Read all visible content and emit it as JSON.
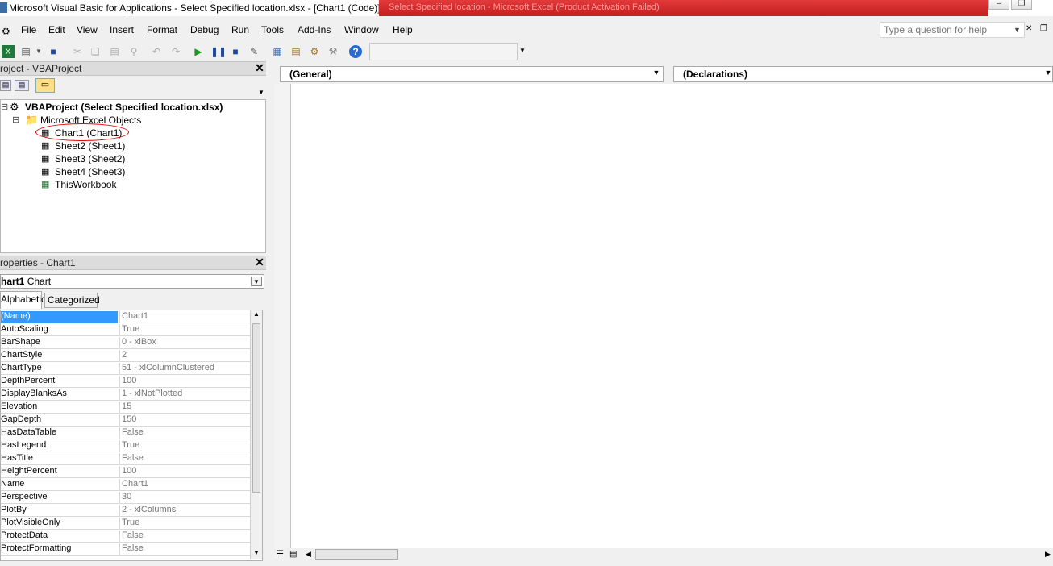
{
  "window": {
    "title": "Microsoft Visual Basic for Applications - Select Specified location.xlsx - [Chart1 (Code)]",
    "background_title": "Select Specified location - Microsoft Excel (Product Activation Failed)"
  },
  "menu": {
    "items": [
      "File",
      "Edit",
      "View",
      "Insert",
      "Format",
      "Debug",
      "Run",
      "Tools",
      "Add-Ins",
      "Window",
      "Help"
    ],
    "help_placeholder": "Type a question for help"
  },
  "project_panel": {
    "title": "roject - VBAProject",
    "root": "VBAProject (Select Specified location.xlsx)",
    "folder": "Microsoft Excel Objects",
    "items": [
      "Chart1 (Chart1)",
      "Sheet2 (Sheet1)",
      "Sheet3 (Sheet2)",
      "Sheet4 (Sheet3)",
      "ThisWorkbook"
    ]
  },
  "properties_panel": {
    "title": "roperties - Chart1",
    "object_name": "hart1",
    "object_type": "Chart",
    "tabs": [
      "Alphabetic",
      "Categorized"
    ],
    "rows": [
      {
        "name": "(Name)",
        "value": "Chart1"
      },
      {
        "name": "AutoScaling",
        "value": "True"
      },
      {
        "name": "BarShape",
        "value": "0 - xlBox"
      },
      {
        "name": "ChartStyle",
        "value": "2"
      },
      {
        "name": "ChartType",
        "value": "51 - xlColumnClustered"
      },
      {
        "name": "DepthPercent",
        "value": "100"
      },
      {
        "name": "DisplayBlanksAs",
        "value": "1 - xlNotPlotted"
      },
      {
        "name": "Elevation",
        "value": "15"
      },
      {
        "name": "GapDepth",
        "value": "150"
      },
      {
        "name": "HasDataTable",
        "value": "False"
      },
      {
        "name": "HasLegend",
        "value": "True"
      },
      {
        "name": "HasTitle",
        "value": "False"
      },
      {
        "name": "HeightPercent",
        "value": "100"
      },
      {
        "name": "Name",
        "value": "Chart1"
      },
      {
        "name": "Perspective",
        "value": "30"
      },
      {
        "name": "PlotBy",
        "value": "2 - xlColumns"
      },
      {
        "name": "PlotVisibleOnly",
        "value": "True"
      },
      {
        "name": "ProtectData",
        "value": "False"
      },
      {
        "name": "ProtectFormatting",
        "value": "False"
      }
    ]
  },
  "code_window": {
    "object_combo": "(General)",
    "procedure_combo": "(Declarations)"
  },
  "colors": {
    "selection": "#3399ff",
    "annotation_circle": "#e00000"
  }
}
